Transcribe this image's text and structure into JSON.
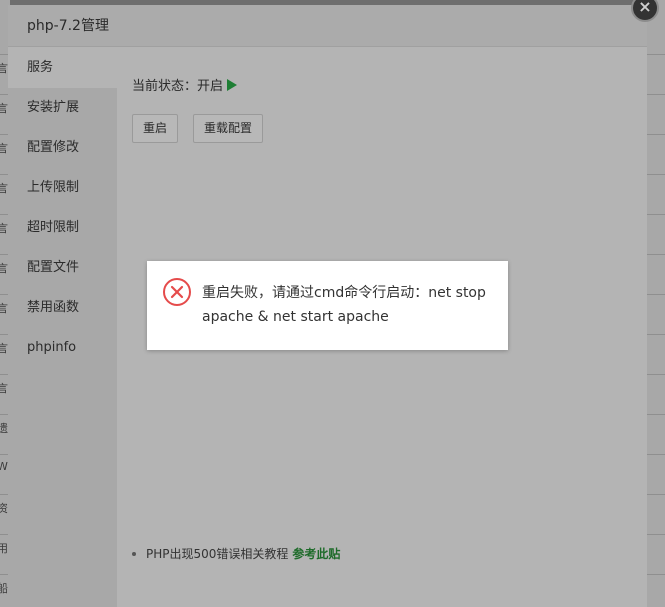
{
  "background": {
    "left_chars": [
      "言",
      "言",
      "言",
      "言",
      "言",
      "言",
      "言",
      "言",
      "言",
      "遗",
      "W",
      "资",
      "用",
      "船"
    ]
  },
  "layer": {
    "title": "php-7.2管理",
    "close_glyph": "×"
  },
  "sidebar": {
    "items": [
      {
        "label": "服务",
        "active": true
      },
      {
        "label": "安装扩展",
        "active": false
      },
      {
        "label": "配置修改",
        "active": false
      },
      {
        "label": "上传限制",
        "active": false
      },
      {
        "label": "超时限制",
        "active": false
      },
      {
        "label": "配置文件",
        "active": false
      },
      {
        "label": "禁用函数",
        "active": false
      },
      {
        "label": "phpinfo",
        "active": false
      }
    ]
  },
  "service": {
    "status_label": "当前状态：开启",
    "restart_label": "重启",
    "reload_label": "重载配置"
  },
  "tips": {
    "text": "PHP出现500错误相关教程",
    "link_label": "参考此贴"
  },
  "message": {
    "text": "重启失败，请通过cmd命令行启动：net stop apache & net start apache",
    "icon": "error-circle-icon"
  },
  "colors": {
    "status_green": "#1e7e34",
    "error_red": "#e54b4b",
    "link_green": "#1e6b2a"
  }
}
